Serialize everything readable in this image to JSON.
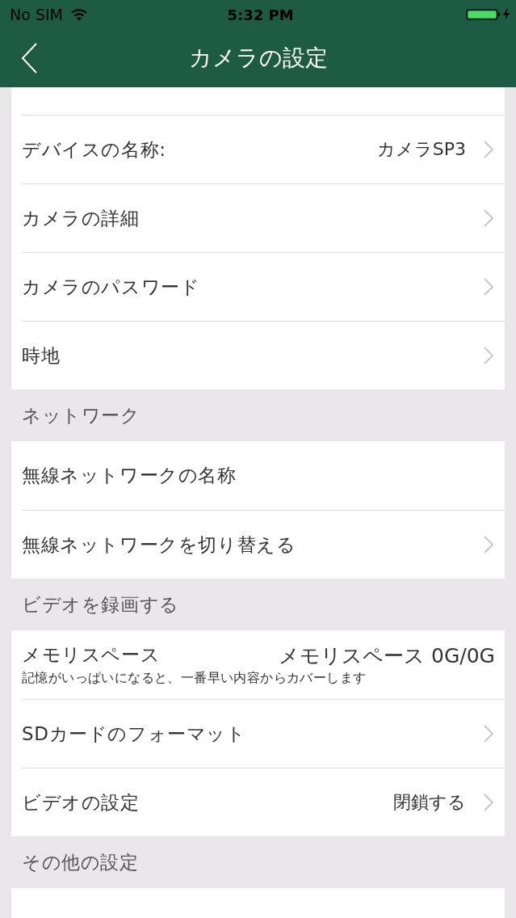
{
  "status_bar": {
    "carrier": "No SIM",
    "time": "5:32 PM"
  },
  "nav_bar": {
    "title": "カメラの設定"
  },
  "sections": [
    {
      "rows": [
        {
          "kind": "link",
          "label": "デバイスの名称:",
          "value": "カメラSP3"
        },
        {
          "kind": "link",
          "label": "カメラの詳細"
        },
        {
          "kind": "link",
          "label": "カメラのパスワード"
        },
        {
          "kind": "link",
          "label": "時地"
        }
      ]
    },
    {
      "header": "ネットワーク",
      "rows": [
        {
          "kind": "info",
          "label": "無線ネットワークの名称"
        },
        {
          "kind": "link",
          "label": "無線ネットワークを切り替える"
        }
      ]
    },
    {
      "header": "ビデオを録画する",
      "rows": [
        {
          "kind": "storage",
          "label": "メモリスペース",
          "subtitle": "記憶がいっぱいになると、一番早い内容からカバーします",
          "value": "メモリスペース 0G/0G"
        },
        {
          "kind": "link",
          "label": "SDカードのフォーマット"
        },
        {
          "kind": "link",
          "label": "ビデオの設定",
          "value": "閉鎖する"
        }
      ]
    },
    {
      "header": "その他の設定"
    }
  ]
}
